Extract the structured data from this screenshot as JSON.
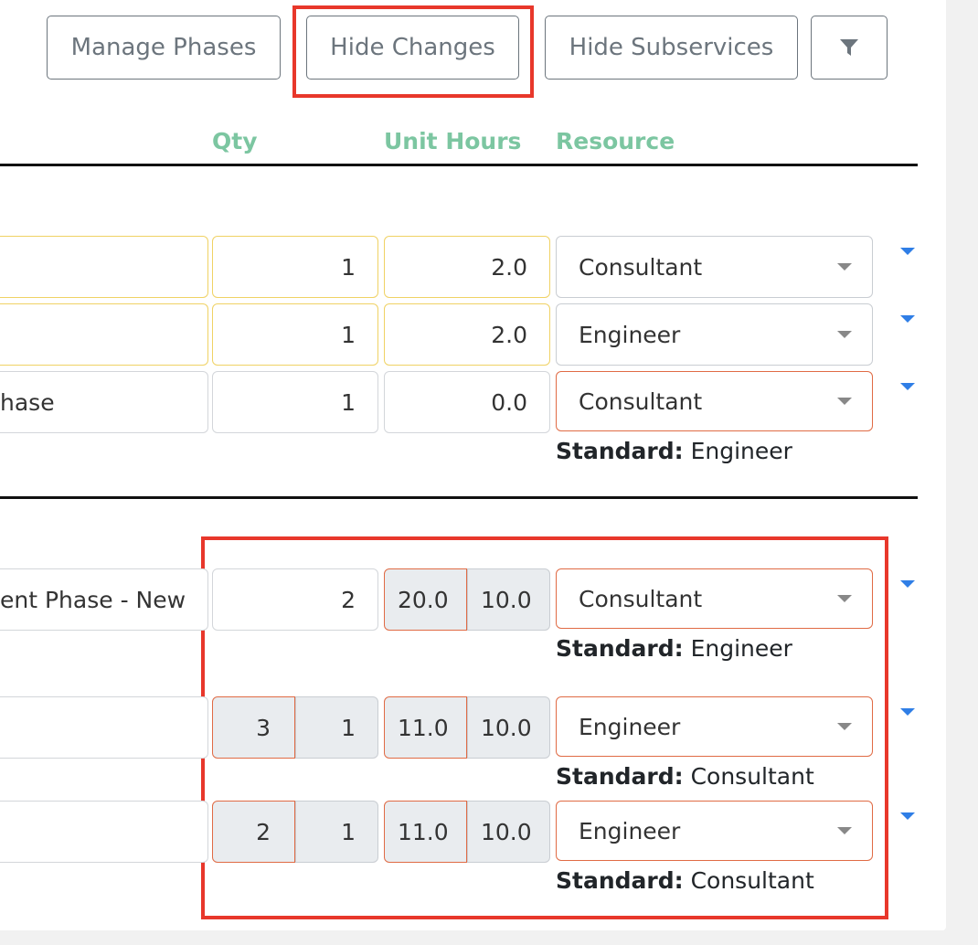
{
  "toolbar": {
    "manage_phases": "Manage Phases",
    "hide_changes": "Hide Changes",
    "hide_subservices": "Hide Subservices",
    "filter_icon": "filter-icon"
  },
  "columns": {
    "qty": "Qty",
    "unit_hours": "Unit Hours",
    "resource": "Resource"
  },
  "group1": {
    "rows": [
      {
        "qty": "1",
        "unit_hours": "2.0",
        "resource": "Consultant"
      },
      {
        "qty": "1",
        "unit_hours": "2.0",
        "resource": "Engineer"
      },
      {
        "name": "hase",
        "qty": "1",
        "unit_hours": "0.0",
        "resource": "Consultant",
        "standard_label": "Standard:",
        "standard_value": "Engineer"
      }
    ]
  },
  "group2": {
    "rows": [
      {
        "name": "ent Phase - New",
        "qty": "2",
        "unit_hours_changed": "20.0",
        "unit_hours_standard": "10.0",
        "resource": "Consultant",
        "standard_label": "Standard:",
        "standard_value": "Engineer"
      },
      {
        "qty_changed": "3",
        "qty_standard": "1",
        "unit_hours_changed": "11.0",
        "unit_hours_standard": "10.0",
        "resource": "Engineer",
        "standard_label": "Standard:",
        "standard_value": "Consultant"
      },
      {
        "qty_changed": "2",
        "qty_standard": "1",
        "unit_hours_changed": "11.0",
        "unit_hours_standard": "10.0",
        "resource": "Engineer",
        "standard_label": "Standard:",
        "standard_value": "Consultant"
      }
    ]
  },
  "colors": {
    "highlight": "#e8372b",
    "header_text": "#7cc6a1",
    "changed_border": "#e06b45",
    "new_border": "#f0d264",
    "caret_blue": "#2f7ee6"
  }
}
